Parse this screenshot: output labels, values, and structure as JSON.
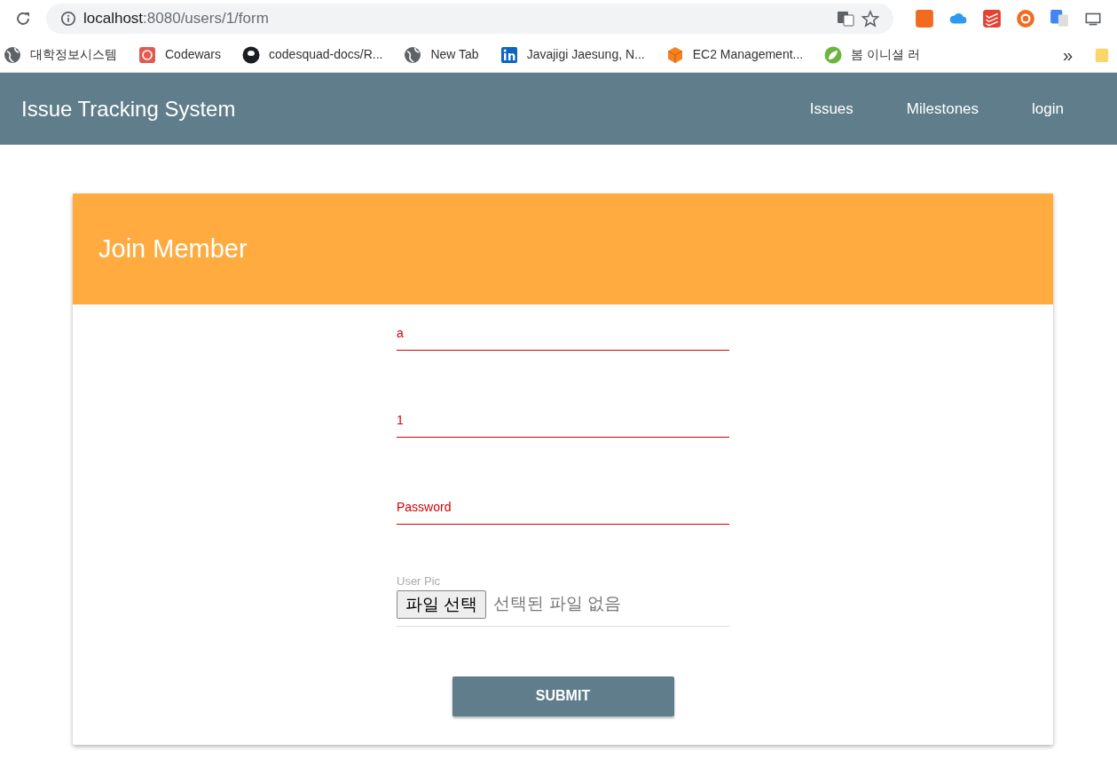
{
  "browser": {
    "url_host": "localhost",
    "url_path": ":8080/users/1/form",
    "bookmarks": [
      {
        "label": "대학정보시스템",
        "kind": "globe"
      },
      {
        "label": "Codewars",
        "kind": "codewars"
      },
      {
        "label": "codesquad-docs/R...",
        "kind": "github"
      },
      {
        "label": "New Tab",
        "kind": "globe"
      },
      {
        "label": "Javajigi Jaesung, N...",
        "kind": "linkedin"
      },
      {
        "label": "EC2 Management...",
        "kind": "cube"
      },
      {
        "label": "봄 이니셜 러",
        "kind": "leaf"
      }
    ],
    "more": "»"
  },
  "navbar": {
    "brand": "Issue Tracking System",
    "links": [
      "Issues",
      "Milestones",
      "login"
    ]
  },
  "card": {
    "title": "Join Member",
    "fields": [
      {
        "kind": "text",
        "value": "a",
        "invalid": true
      },
      {
        "kind": "text",
        "value": "1",
        "invalid": true
      },
      {
        "kind": "password",
        "placeholder": "Password",
        "invalid": true
      },
      {
        "kind": "file",
        "label": "User Pic",
        "button": "파일 선택",
        "status": "선택된 파일 없음",
        "invalid": false
      }
    ],
    "submit": "SUBMIT"
  }
}
